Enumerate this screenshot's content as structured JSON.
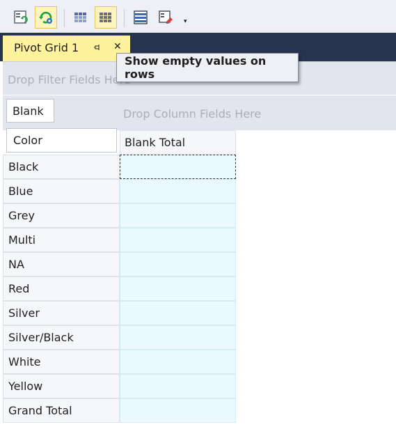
{
  "toolbar": {
    "buttons": [
      {
        "icon": "refresh-layout-icon",
        "active": false
      },
      {
        "icon": "refresh-settings-icon",
        "active": true
      },
      {
        "icon": "show-empty-columns-icon",
        "active": false
      },
      {
        "icon": "show-empty-rows-icon",
        "active": true
      },
      {
        "icon": "layout-icon",
        "active": false
      },
      {
        "icon": "clear-format-icon",
        "active": false
      }
    ],
    "overflow_glyph": "▾"
  },
  "document_tab": {
    "title": "Pivot Grid 1",
    "close_glyph": "✕"
  },
  "tooltip": {
    "text": "Show empty values on rows"
  },
  "filter_area": {
    "placeholder": "Drop Filter Fields Here"
  },
  "column_area": {
    "placeholder": "Drop Column Fields Here",
    "data_field": "Blank"
  },
  "row_area": {
    "row_field": "Color"
  },
  "pivot": {
    "column_header": "Blank Total",
    "rows": [
      "Black",
      "Blue",
      "Grey",
      "Multi",
      "NA",
      "Red",
      "Silver",
      "Silver/Black",
      "White",
      "Yellow",
      "Grand Total"
    ]
  },
  "colors": {
    "dark_bar": "#283350",
    "tab_active": "#fff29d",
    "cell_bg": "#eaf9fd",
    "area_bg": "#e1e5ee"
  }
}
